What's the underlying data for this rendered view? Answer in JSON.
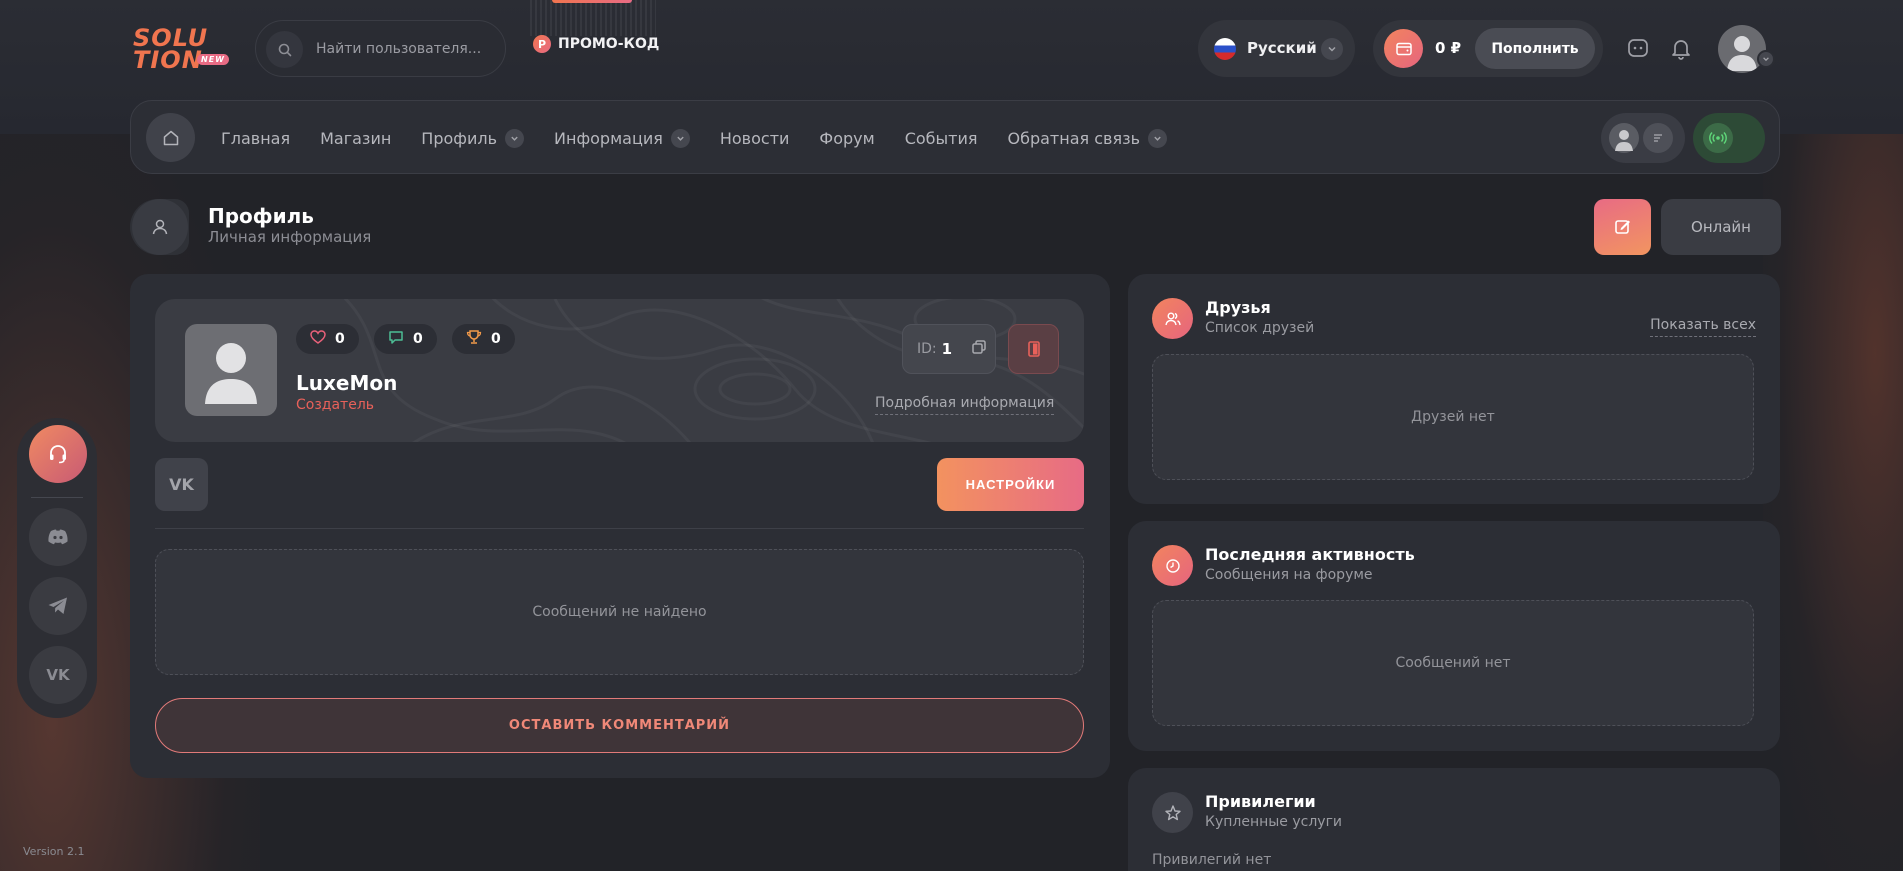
{
  "header": {
    "logo_line1": "SOLU",
    "logo_line2": "TION",
    "logo_badge": "NEW",
    "search_placeholder": "Найти пользователя...",
    "promo_badge": "P",
    "promo_label": "ПРОМО-КОД",
    "language": "Русский",
    "balance": "0 ₽",
    "topup_label": "Пополнить"
  },
  "nav": {
    "items": [
      {
        "label": "Главная",
        "dropdown": false
      },
      {
        "label": "Магазин",
        "dropdown": false
      },
      {
        "label": "Профиль",
        "dropdown": true
      },
      {
        "label": "Информация",
        "dropdown": true
      },
      {
        "label": "Новости",
        "dropdown": false
      },
      {
        "label": "Форум",
        "dropdown": false
      },
      {
        "label": "События",
        "dropdown": false
      },
      {
        "label": "Обратная связь",
        "dropdown": true
      }
    ]
  },
  "page": {
    "title": "Профиль",
    "subtitle": "Личная информация",
    "online_label": "Онлайн"
  },
  "profile": {
    "likes": "0",
    "comments": "0",
    "trophies": "0",
    "username": "LuxeMon",
    "role": "Создатель",
    "id_label": "ID:",
    "id_value": "1",
    "details_link": "Подробная информация",
    "vk_label": "VK",
    "settings_label": "НАСТРОЙКИ",
    "no_messages": "Сообщений не найдено",
    "comment_label": "ОСТАВИТЬ КОММЕНТАРИЙ"
  },
  "friends": {
    "title": "Друзья",
    "subtitle": "Список друзей",
    "show_all": "Показать всех",
    "empty": "Друзей нет"
  },
  "activity": {
    "title": "Последняя активность",
    "subtitle": "Сообщения на форуме",
    "empty": "Сообщений нет"
  },
  "privileges": {
    "title": "Привилегии",
    "subtitle": "Купленные услуги",
    "empty": "Привилегий нет"
  },
  "sidebar": {
    "vk_label": "VK"
  },
  "footer": {
    "version": "Version 2.1"
  },
  "colors": {
    "accent_orange": "#f2845e",
    "accent_pink": "#e6657e",
    "background": "#222328",
    "card": "#2c2e35"
  }
}
